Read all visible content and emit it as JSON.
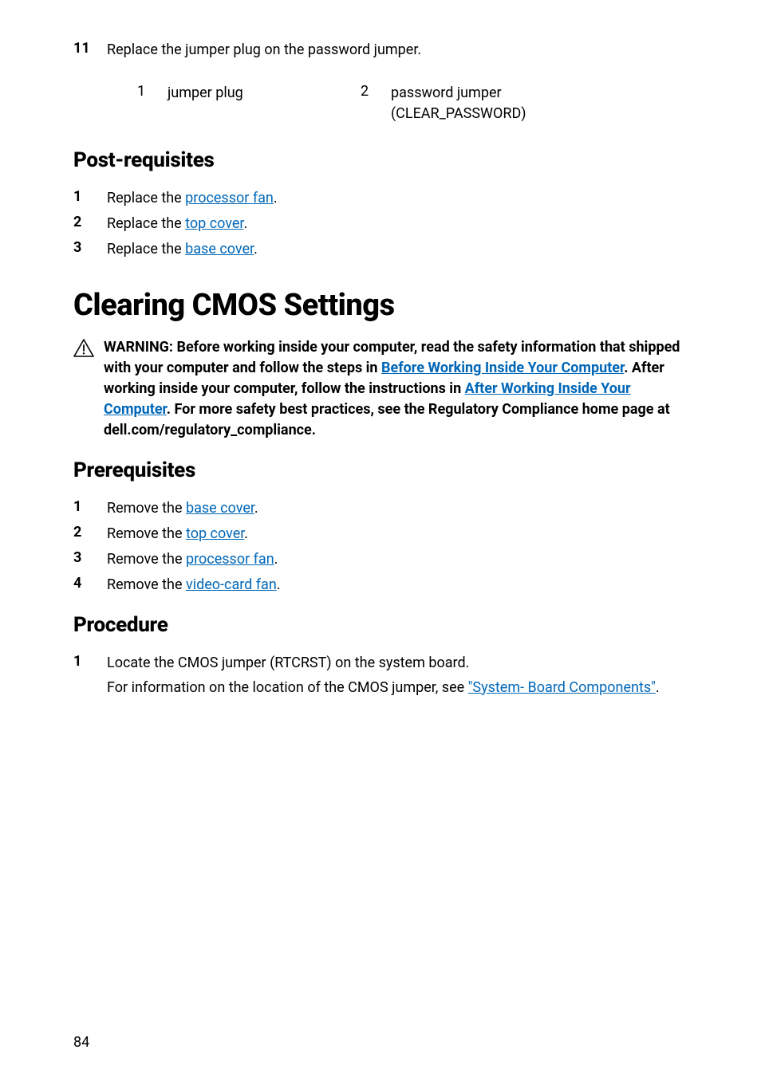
{
  "step11": {
    "num": "11",
    "text": "Replace the jumper plug on the password jumper."
  },
  "callouts": {
    "c1_num": "1",
    "c1_text": "jumper plug",
    "c2_num": "2",
    "c2_text_l1": "password jumper",
    "c2_text_l2": "(CLEAR_PASSWORD)"
  },
  "postreq": {
    "heading": "Post-requisites",
    "items": [
      {
        "num": "1",
        "prefix": "Replace the ",
        "link": "processor fan",
        "suffix": "."
      },
      {
        "num": "2",
        "prefix": "Replace the ",
        "link": "top cover",
        "suffix": "."
      },
      {
        "num": "3",
        "prefix": "Replace the ",
        "link": "base cover",
        "suffix": "."
      }
    ]
  },
  "title": "Clearing CMOS Settings",
  "warning": {
    "p1": "WARNING: Before working inside your computer, read the safety information that shipped with your computer and follow the steps in ",
    "link1": "Before Working Inside Your Computer",
    "p2": ". After working inside your computer, follow the instructions in ",
    "link2": "After Working Inside Your Computer",
    "p3": ". For more safety best practices, see the Regulatory Compliance home page at dell.com/regulatory_compliance."
  },
  "prereq": {
    "heading": "Prerequisites",
    "items": [
      {
        "num": "1",
        "prefix": "Remove the ",
        "link": "base cover",
        "suffix": "."
      },
      {
        "num": "2",
        "prefix": "Remove the ",
        "link": "top cover",
        "suffix": "."
      },
      {
        "num": "3",
        "prefix": "Remove the ",
        "link": "processor fan",
        "suffix": "."
      },
      {
        "num": "4",
        "prefix": "Remove the ",
        "link": "video-card fan",
        "suffix": "."
      }
    ]
  },
  "procedure": {
    "heading": "Procedure",
    "step1": {
      "num": "1",
      "line1": "Locate the CMOS jumper (RTCRST) on the system board.",
      "line2a": "For information on the location of the CMOS jumper, see ",
      "link": "\"System- Board Components\"",
      "line2b": "."
    }
  },
  "page_number": "84"
}
